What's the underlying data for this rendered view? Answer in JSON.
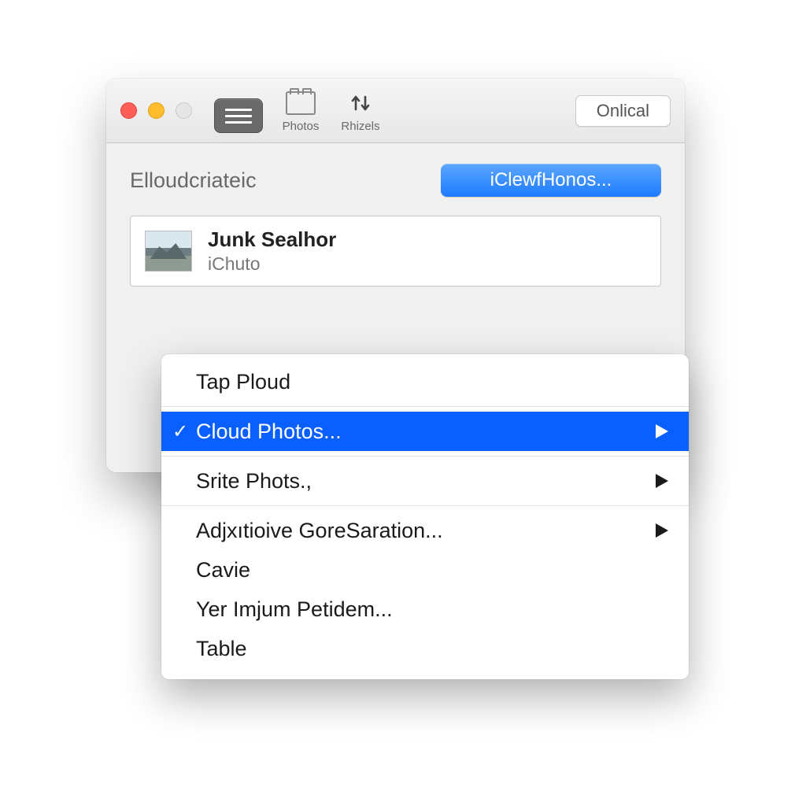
{
  "toolbar": {
    "items": [
      {
        "label": ""
      },
      {
        "label": "Photos"
      },
      {
        "label": "Rhizels"
      }
    ],
    "right_button": "Onlical"
  },
  "section": {
    "title": "Elloudcriateic",
    "action_button": "iClewfHonos..."
  },
  "account": {
    "name": "Junk Sealhor",
    "subtitle": "iChuto"
  },
  "menu": {
    "items": [
      {
        "label": "Tap Ploud",
        "checked": false,
        "submenu": false,
        "selected": false
      },
      {
        "label": "Cloud Photos...",
        "checked": true,
        "submenu": true,
        "selected": true
      },
      {
        "label": "Srite Phots.,",
        "checked": false,
        "submenu": true,
        "selected": false
      },
      {
        "label": "Adjxıtioive GoreSaration...",
        "checked": false,
        "submenu": true,
        "selected": false
      },
      {
        "label": "Cavie",
        "checked": false,
        "submenu": false,
        "selected": false
      },
      {
        "label": "Yer Imjum Petidem...",
        "checked": false,
        "submenu": false,
        "selected": false
      },
      {
        "label": "Table",
        "checked": false,
        "submenu": false,
        "selected": false
      }
    ]
  }
}
